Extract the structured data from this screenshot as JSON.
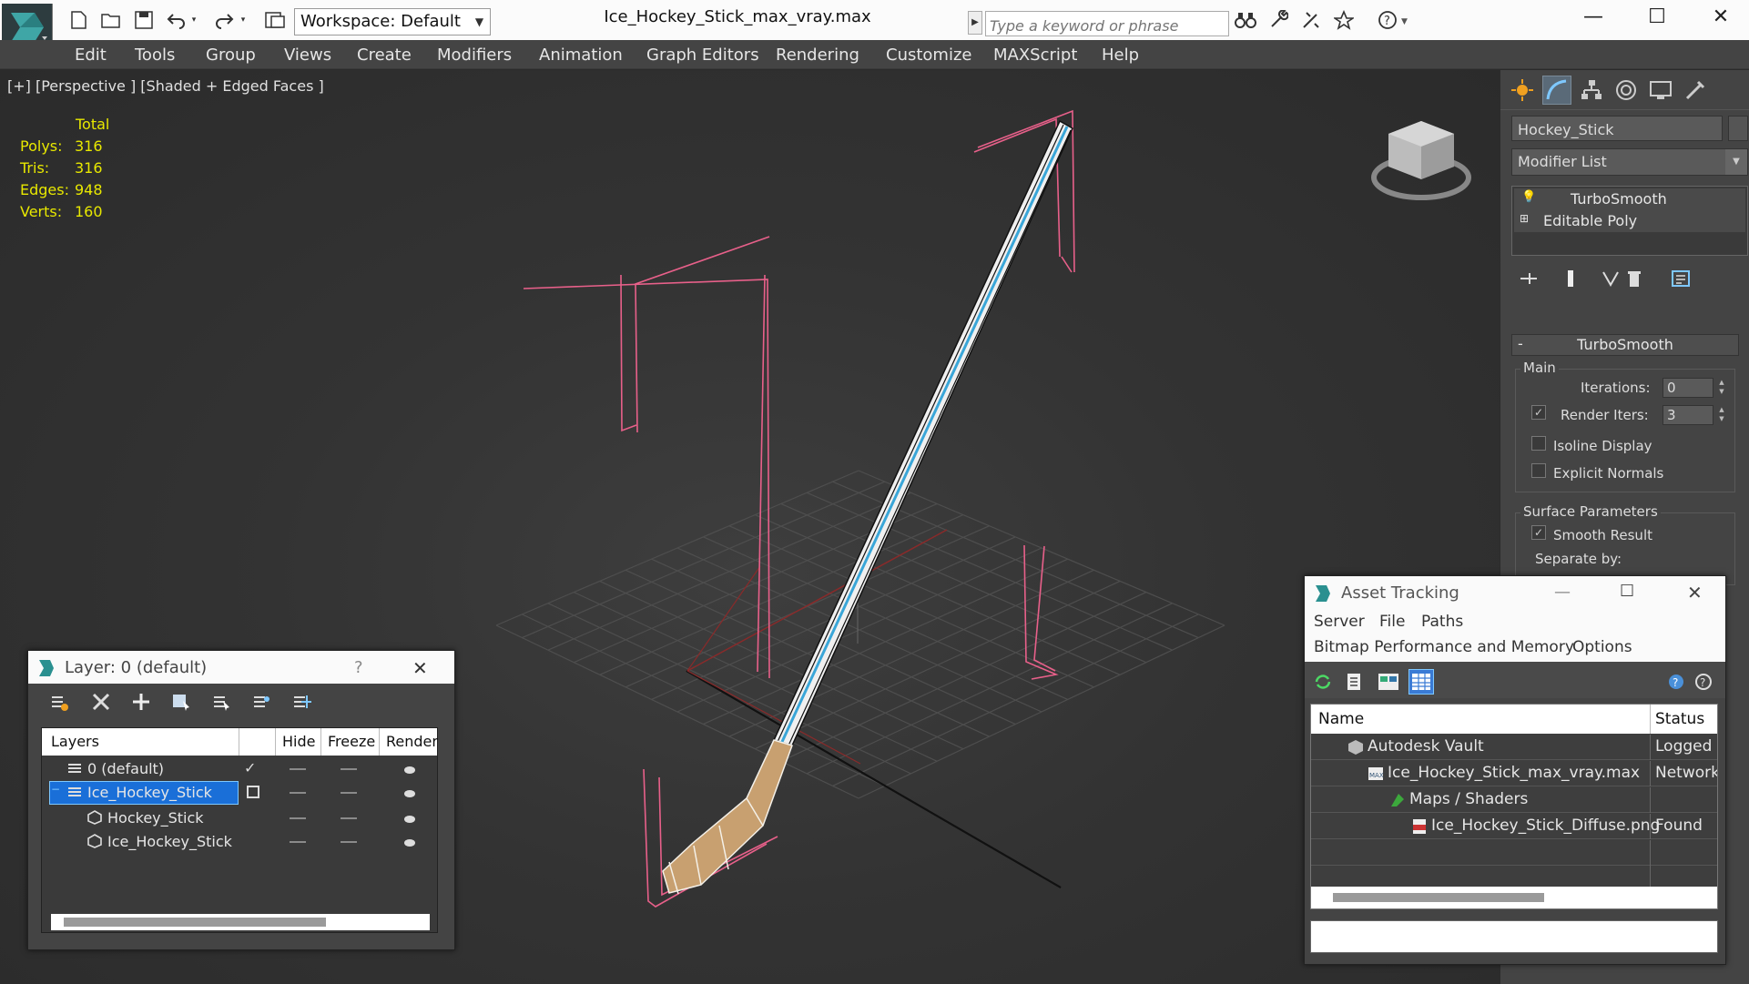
{
  "app": {
    "file_title": "Ice_Hockey_Stick_max_vray.max",
    "workspace": "Workspace: Default",
    "search_placeholder": "Type a keyword or phrase",
    "minimize": "—",
    "maximize": "☐",
    "close": "✕"
  },
  "menu": [
    "Edit",
    "Tools",
    "Group",
    "Views",
    "Create",
    "Modifiers",
    "Animation",
    "Graph Editors",
    "Rendering",
    "Customize",
    "MAXScript",
    "Help"
  ],
  "viewport": {
    "label": "[+] [Perspective ] [Shaded + Edged Faces ]",
    "stats_header": "Total",
    "stats": [
      {
        "label": "Polys:",
        "value": "316"
      },
      {
        "label": "Tris:",
        "value": "316"
      },
      {
        "label": "Edges:",
        "value": "948"
      },
      {
        "label": "Verts:",
        "value": "160"
      }
    ],
    "colors": {
      "stats": "#e8e800",
      "bbox": "#e8608a",
      "stick_stripe": "#3aa6d8",
      "blade": "#c8a070",
      "grid": "#4e4e4e"
    }
  },
  "command_panel": {
    "object_name": "Hockey_Stick",
    "modifier_list": "Modifier List",
    "stack": [
      "TurboSmooth",
      "Editable Poly"
    ],
    "rollout_title": "TurboSmooth",
    "rollout_minus": "-",
    "main_group": "Main",
    "iterations_label": "Iterations:",
    "iterations_value": "0",
    "render_iters_label": "Render Iters:",
    "render_iters_value": "3",
    "render_iters_checked": "✓",
    "isoline_label": "Isoline Display",
    "explicit_normals_label": "Explicit Normals",
    "surface_group": "Surface Parameters",
    "smooth_result_label": "Smooth Result",
    "smooth_result_checked": "✓",
    "separate_by_label": "Separate by:"
  },
  "layer_window": {
    "title": "Layer: 0 (default)",
    "help": "?",
    "close": "✕",
    "columns": [
      "Layers",
      "Hide",
      "Freeze",
      "Render"
    ],
    "rows": [
      {
        "name": "0 (default)",
        "current": "✓"
      },
      {
        "name": "Ice_Hockey_Stick",
        "toggle": "−"
      },
      {
        "name": "Hockey_Stick"
      },
      {
        "name": "Ice_Hockey_Stick"
      }
    ]
  },
  "asset_window": {
    "title": "Asset Tracking",
    "minimize": "—",
    "maximize": "☐",
    "close": "✕",
    "menu": [
      "Server",
      "File",
      "Paths",
      "Bitmap Performance and Memory",
      "Options"
    ],
    "columns": [
      "Name",
      "Status"
    ],
    "rows": [
      {
        "name": "Autodesk Vault",
        "status": "Logged Out"
      },
      {
        "name": "Ice_Hockey_Stick_max_vray.max",
        "status": "Network"
      },
      {
        "name": "Maps / Shaders",
        "status": ""
      },
      {
        "name": "Ice_Hockey_Stick_Diffuse.png",
        "status": "Found"
      }
    ]
  }
}
